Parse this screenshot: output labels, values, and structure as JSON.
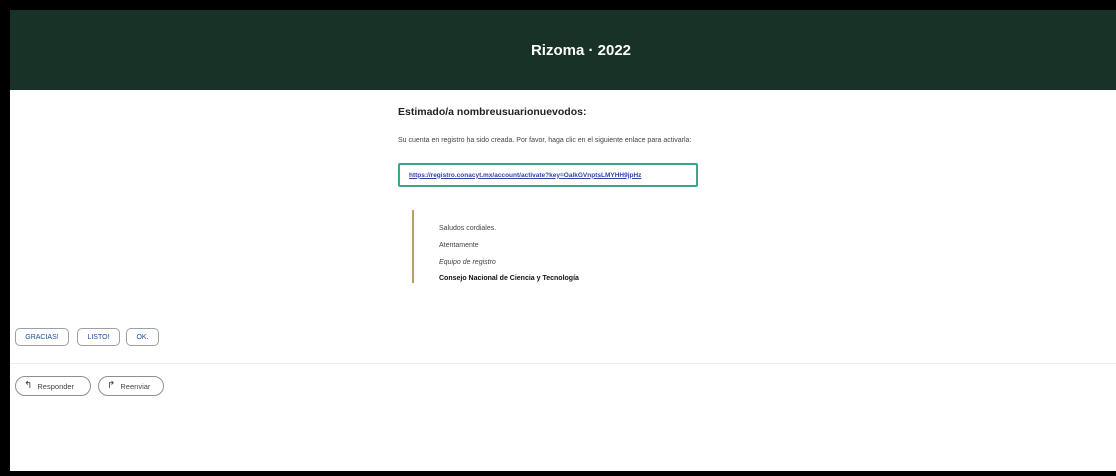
{
  "header": {
    "title": "Rizoma · 2022",
    "bg_color": "#193227"
  },
  "email": {
    "greeting": "Estimado/a nombreusuarionuevodos:",
    "body_text": "Su cuenta en registro ha sido creada. Por favor, haga clic en el siguiente enlace para activarla:",
    "activation_link": "https://registro.conacyt.mx/account/activate?key=OalkGVnptsLMYHH9jpHz",
    "link_highlight_color": "#3da48c",
    "signature": {
      "line1": "Saludos cordiales.",
      "line2": "Atentamente",
      "line3": "Equipo de registro",
      "line4": "Consejo Nacional de Ciencia y Tecnología",
      "bar_color": "#b8a05e"
    }
  },
  "quick_replies": [
    "GRACIAS!",
    "LISTO!",
    "OK."
  ],
  "actions": {
    "reply_label": "Responder",
    "reply_icon": "reply-icon",
    "forward_label": "Reenviar",
    "forward_icon": "forward-icon"
  }
}
